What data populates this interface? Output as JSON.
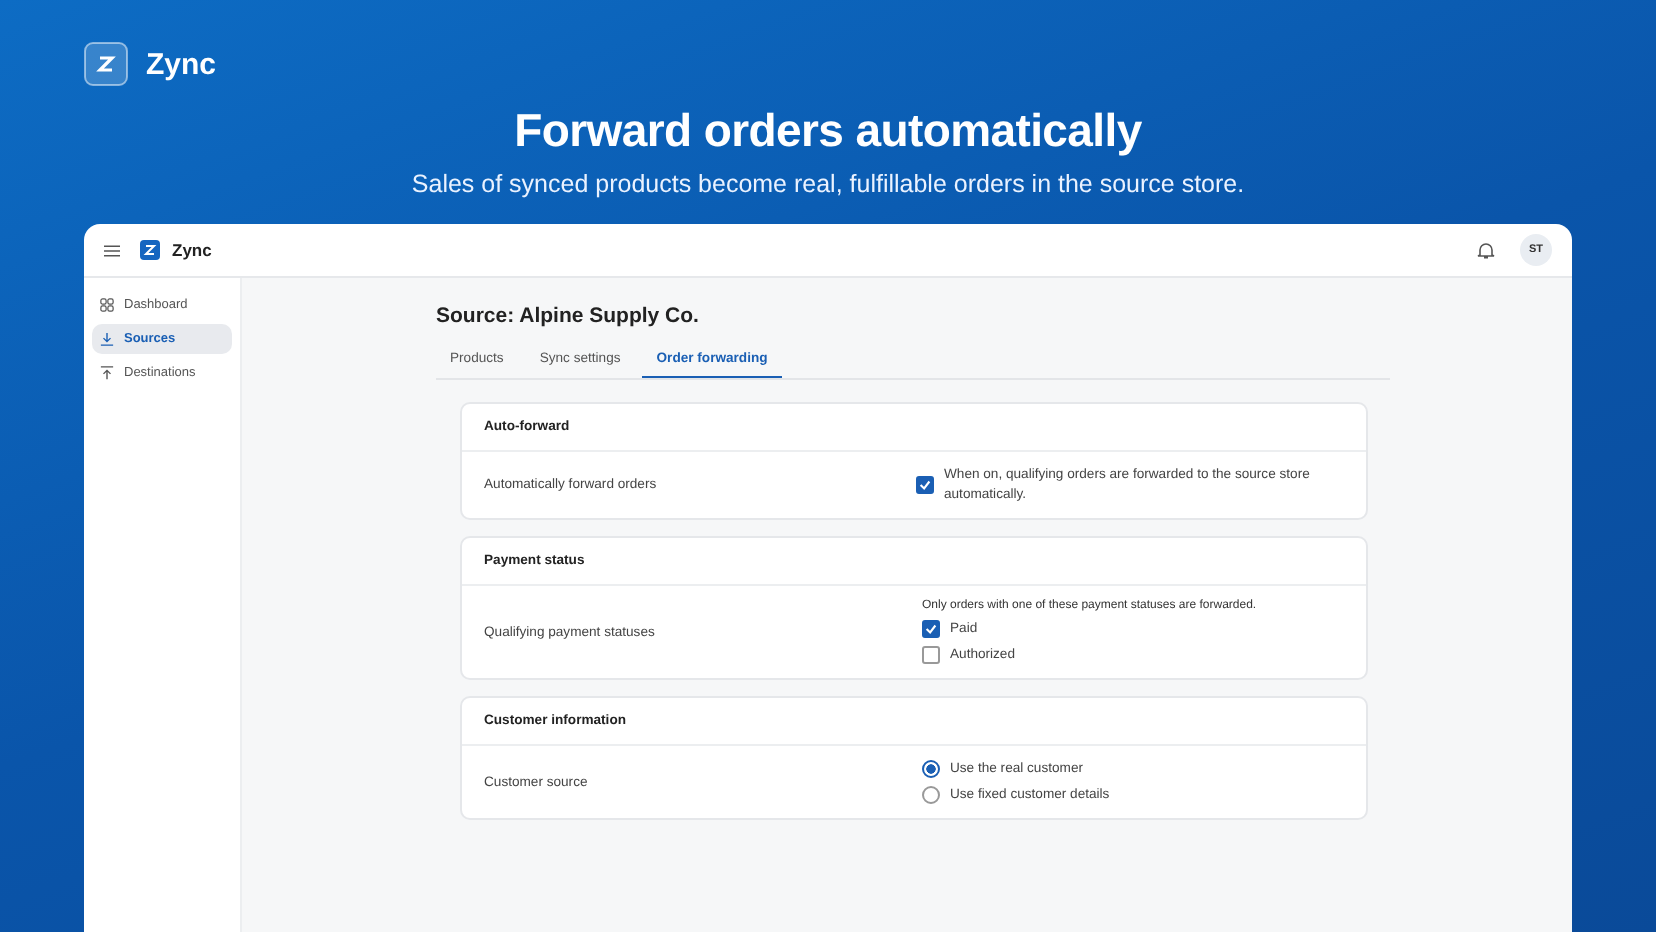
{
  "brand": {
    "name": "Zync"
  },
  "hero": {
    "title": "Forward orders automatically",
    "subtitle": "Sales of synced products become real, fulfillable orders in the source store."
  },
  "app": {
    "topbar": {
      "brand": "Zync",
      "avatar": "ST"
    },
    "sidebar": {
      "items": [
        {
          "label": "Dashboard",
          "selected": false
        },
        {
          "label": "Sources",
          "selected": true
        },
        {
          "label": "Destinations",
          "selected": false
        }
      ]
    },
    "page_title": "Source: Alpine Supply Co.",
    "tabs": [
      {
        "label": "Products",
        "selected": false
      },
      {
        "label": "Sync settings",
        "selected": false
      },
      {
        "label": "Order forwarding",
        "selected": true
      }
    ],
    "sections": [
      {
        "title": "Auto-forward",
        "row": {
          "label": "Automatically forward orders",
          "kind": "toggle",
          "checked": true,
          "description": "When on, qualifying orders are forwarded to the source store automatically."
        }
      },
      {
        "title": "Payment status",
        "row": {
          "label": "Qualifying payment statuses",
          "kind": "checklist",
          "note": "Only orders with one of these payment statuses are forwarded.",
          "options": [
            {
              "label": "Paid",
              "checked": true
            },
            {
              "label": "Authorized",
              "checked": false
            }
          ]
        }
      },
      {
        "title": "Customer information",
        "row": {
          "label": "Customer source",
          "kind": "radio",
          "options": [
            {
              "label": "Use the real customer",
              "selected": true
            },
            {
              "label": "Use fixed customer details",
              "selected": false
            }
          ]
        }
      }
    ]
  }
}
